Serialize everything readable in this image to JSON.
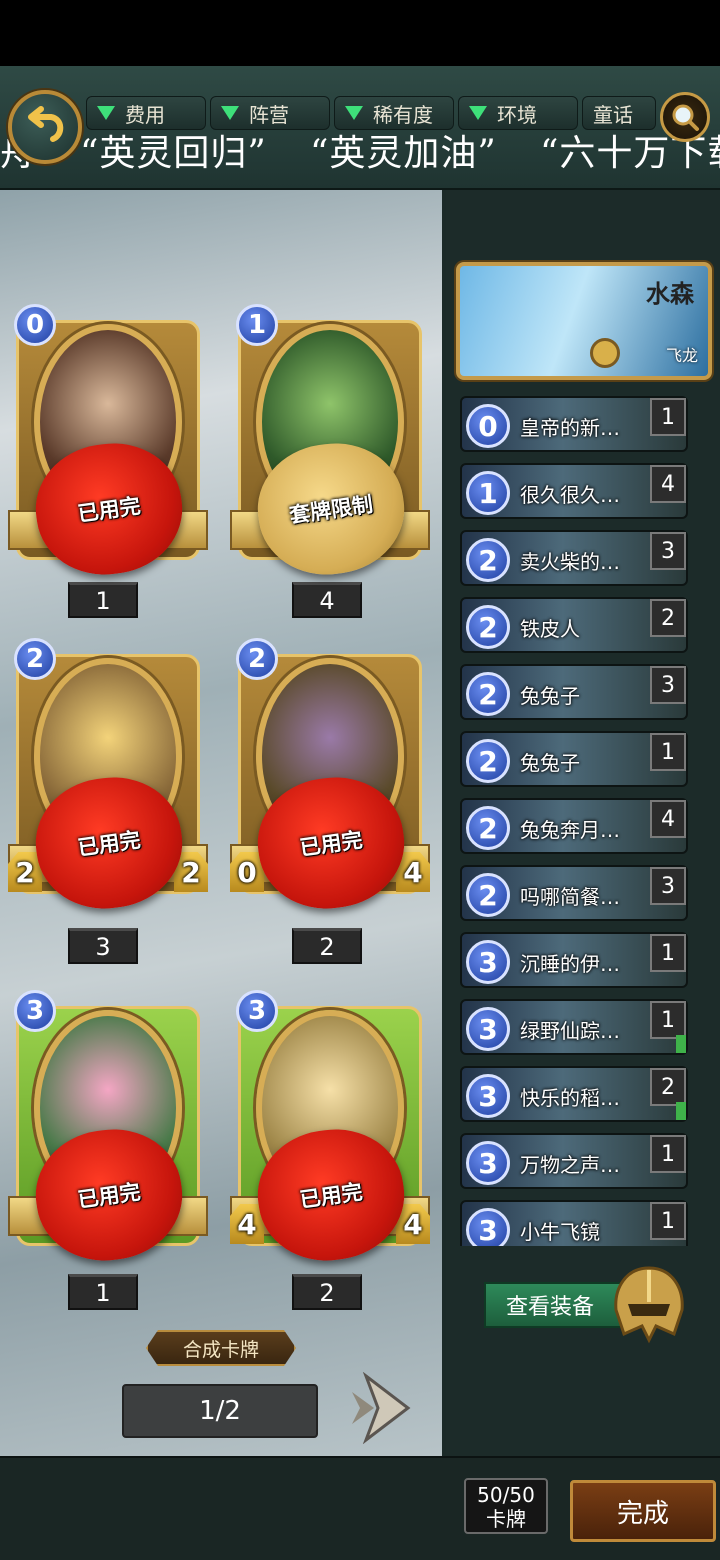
{
  "filters": [
    "费用",
    "阵营",
    "稀有度",
    "环境",
    "童话"
  ],
  "marquee": [
    "舟\"",
    "“英灵回归”",
    "“英灵加油”",
    "“六十万下载"
  ],
  "cards": [
    {
      "cost": "0",
      "count": "1",
      "seal": "已用完",
      "seal_type": "red"
    },
    {
      "cost": "1",
      "count": "4",
      "seal": "套牌限制",
      "seal_type": "gold"
    },
    {
      "cost": "2",
      "count": "3",
      "seal": "已用完",
      "seal_type": "red",
      "atk": "2",
      "hp": "2"
    },
    {
      "cost": "2",
      "count": "2",
      "seal": "已用完",
      "seal_type": "red",
      "atk": "0",
      "hp": "4"
    },
    {
      "cost": "3",
      "count": "1",
      "seal": "已用完",
      "seal_type": "red"
    },
    {
      "cost": "3",
      "count": "2",
      "seal": "已用完",
      "seal_type": "red",
      "atk": "4",
      "hp": "4"
    }
  ],
  "compose_label": "合成卡牌",
  "page_indicator": "1/2",
  "hero": {
    "name": "水森",
    "type": "飞龙"
  },
  "deck": [
    {
      "cost": "0",
      "name": "皇帝的新…",
      "count": "1"
    },
    {
      "cost": "1",
      "name": "很久很久…",
      "count": "4"
    },
    {
      "cost": "2",
      "name": "卖火柴的…",
      "count": "3"
    },
    {
      "cost": "2",
      "name": "铁皮人",
      "count": "2"
    },
    {
      "cost": "2",
      "name": "兔兔子",
      "count": "3"
    },
    {
      "cost": "2",
      "name": "兔兔子",
      "count": "1"
    },
    {
      "cost": "2",
      "name": "兔兔奔月…",
      "count": "4"
    },
    {
      "cost": "2",
      "name": "吗哪简餐…",
      "count": "3"
    },
    {
      "cost": "3",
      "name": "沉睡的伊…",
      "count": "1"
    },
    {
      "cost": "3",
      "name": "绿野仙踪…",
      "count": "1"
    },
    {
      "cost": "3",
      "name": "快乐的稻…",
      "count": "2"
    },
    {
      "cost": "3",
      "name": "万物之声…",
      "count": "1"
    },
    {
      "cost": "3",
      "name": "小牛飞镜",
      "count": "1"
    }
  ],
  "view_equipment": "查看装备",
  "deck_count": {
    "value": "50/50",
    "label": "卡牌"
  },
  "done_label": "完成"
}
